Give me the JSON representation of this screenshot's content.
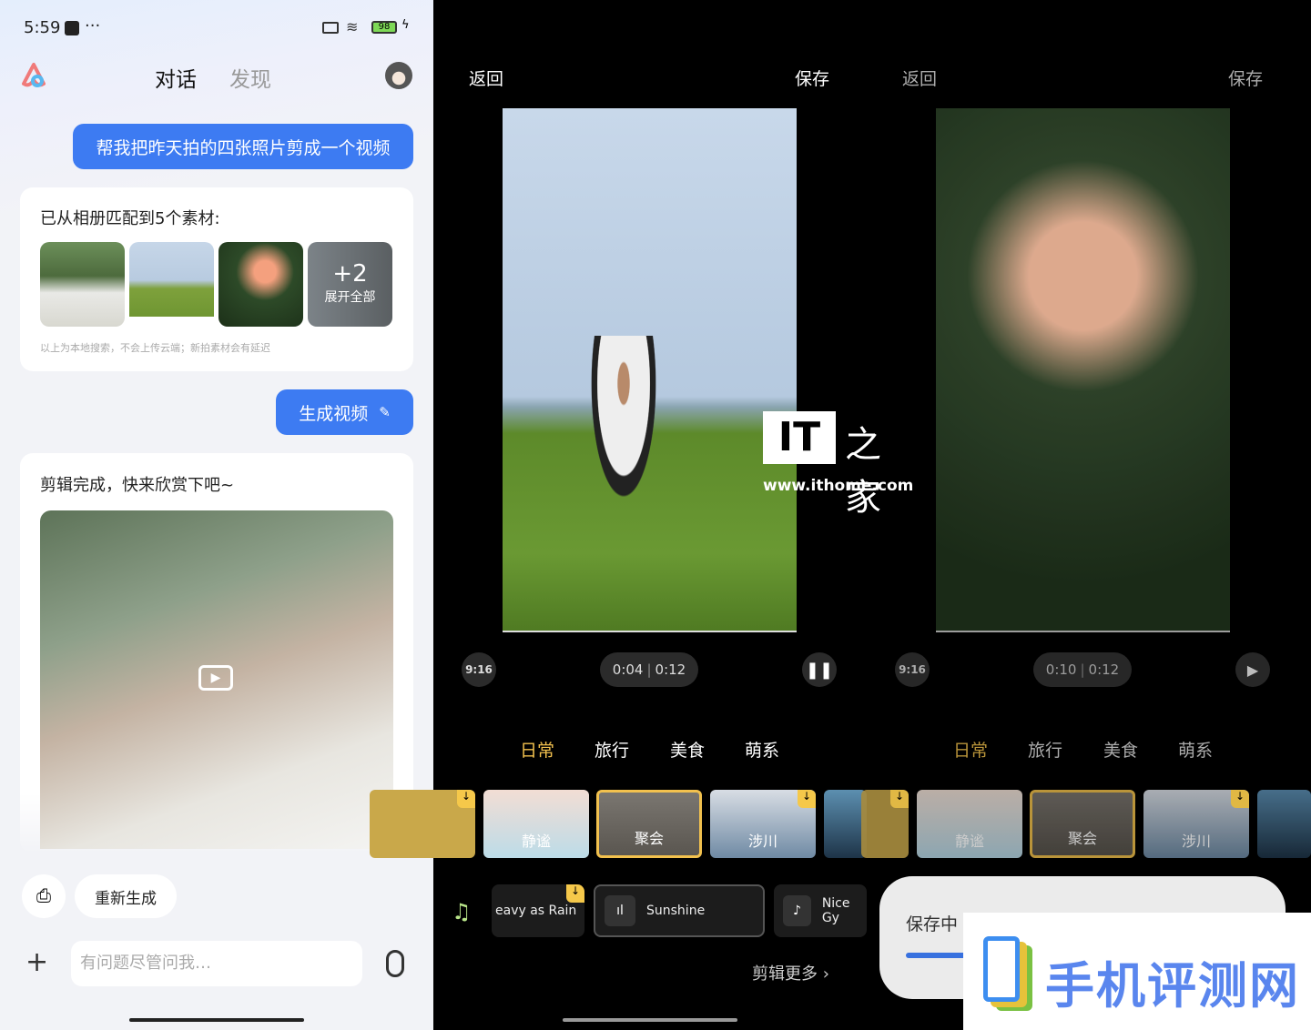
{
  "status": {
    "time": "5:59",
    "more": "···",
    "battery": "98"
  },
  "header": {
    "tab_chat": "对话",
    "tab_discover": "发现"
  },
  "chat": {
    "user_msg": "帮我把昨天拍的四张照片剪成一个视频",
    "match_title": "已从相册匹配到5个素材:",
    "more_count": "+2",
    "expand_all": "展开全部",
    "note": "以上为本地搜索，不会上传云端；新拍素材会有延迟",
    "generate_btn": "生成视频",
    "done_msg": "剪辑完成，快来欣赏下吧~",
    "regenerate": "重新生成",
    "input_placeholder": "有问题尽管问我…"
  },
  "editor_left": {
    "back": "返回",
    "save": "保存",
    "ratio": "9:16",
    "current": "0:04",
    "total": "0:12",
    "state": "playing"
  },
  "editor_right": {
    "back": "返回",
    "save": "保存",
    "ratio": "9:16",
    "current": "0:10",
    "total": "0:12",
    "state": "paused",
    "saving_label": "保存中"
  },
  "categories": [
    "日常",
    "旅行",
    "美食",
    "萌系"
  ],
  "templates": [
    "静谧",
    "聚会",
    "涉川"
  ],
  "music": [
    "eavy as Rain",
    "Sunshine",
    "Nice Gy"
  ],
  "edit_more": "剪辑更多",
  "watermarks": {
    "ithome_url": "www.ithome.com",
    "ithome_logo": "IT之家",
    "site": "手机评测网"
  },
  "colors": {
    "accent_blue": "#3d7bf2",
    "category_active": "#f2c14e"
  }
}
